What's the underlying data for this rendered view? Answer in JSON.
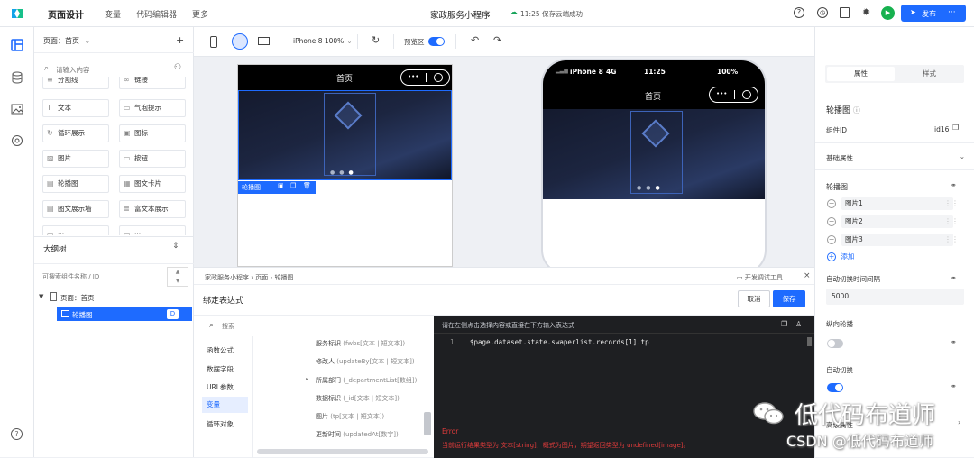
{
  "topbar": {
    "title": "页面设计",
    "tabs": [
      "变量",
      "代码编辑器",
      "更多"
    ],
    "app_name": "家政服务小程序",
    "save_status": "11:25 保存云端成功",
    "publish": "发布",
    "more": "···"
  },
  "rail": {
    "icons": [
      "pages-icon",
      "database-icon",
      "image-icon",
      "settings-icon",
      "help-icon"
    ]
  },
  "left": {
    "page_select": "页面：首页",
    "add": "+",
    "search_placeholder": "请输入内容",
    "components": [
      "分割线",
      "链接",
      "文本",
      "气泡提示",
      "循环展示",
      "图标",
      "图片",
      "按钮",
      "轮播图",
      "图文卡片",
      "图文展示墙",
      "富文本展示",
      "···",
      "···"
    ],
    "outline_title": "大纲树",
    "outline_search_placeholder": "可搜索组件名称 / ID",
    "tree_page": "页面：首页",
    "tree_node": "轮播图",
    "tree_badge": "D"
  },
  "toolbar": {
    "device": "iPhone 8 100%",
    "preview": "预览区",
    "preview_on": true
  },
  "canvas": {
    "page_title": "首页",
    "selected_label": "轮播图",
    "phone_carrier": "iPhone 8",
    "phone_network": "4G",
    "phone_time": "11:25",
    "phone_battery": "100%",
    "capsule_dots": "•••"
  },
  "bottom": {
    "breadcrumb": [
      "家政服务小程序",
      "页面",
      "轮播图"
    ],
    "devtools": "开发调试工具",
    "title": "绑定表达式",
    "cancel": "取消",
    "save": "保存",
    "search_placeholder": "搜索",
    "categories": [
      "函数公式",
      "数据字段",
      "URL参数",
      "变量",
      "循环对象"
    ],
    "active_category": "变量",
    "vars": [
      {
        "name": "服务标识",
        "type": "(fwbs[文本 | 短文本])"
      },
      {
        "name": "修改人",
        "type": "(updateBy[文本 | 短文本])"
      },
      {
        "name": "所属部门",
        "type": "(_departmentList[数组])"
      },
      {
        "name": "数据标识",
        "type": "(_id[文本 | 短文本])"
      },
      {
        "name": "图片",
        "type": "(tp[文本 | 短文本])"
      },
      {
        "name": "更新时间",
        "type": "(updatedAt[数字])"
      }
    ],
    "editor_hint": "请在左侧点击选择内容或直接在下方输入表达式",
    "line_no": "1",
    "code": "$page.dataset.state.swaperlist.records[1].tp",
    "error_title": "Error",
    "error_msg": "当前运行结果类型为 文本[string]，概式为图片，期望返回类型为 undefined[image]。"
  },
  "right": {
    "tabs": [
      "属性",
      "样式"
    ],
    "comp_title": "轮播图",
    "comp_id_label": "组件ID",
    "comp_id": "id16",
    "section": "基础属性",
    "carousel_label": "轮播图",
    "pictures": [
      "图片1",
      "图片2",
      "图片3"
    ],
    "add": "添加",
    "interval_label": "自动切换时间间隔",
    "interval_value": "5000",
    "vertical_label": "纵向轮播",
    "vertical_on": false,
    "auto_label": "自动切换",
    "auto_on": true,
    "more_section": "高级属性"
  },
  "watermark": {
    "brand": "低代码布道师",
    "csdn": "CSDN @低代码布道师"
  },
  "colors": {
    "primary": "#1e6bff",
    "dark_nav": "#000000",
    "error": "#e03b3b",
    "editor_bg": "#1e1f22"
  }
}
